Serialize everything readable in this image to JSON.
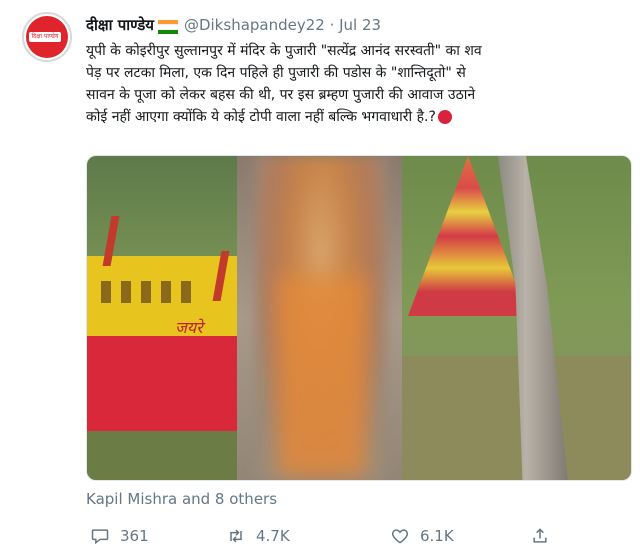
{
  "tweet": {
    "author_name": "दीक्षा पाण्डेय",
    "handle": "@Dikshapandey22 · Jul 23",
    "avatar_text": "दिक्षा पाण्डेय",
    "lines": [
      "यूपी के कोइरीपुर सुल्तानपुर में मंदिर के पुजारी \"सत्येंद्र आनंद सरस्वती\" का शव",
      "पेड़ पर लटका मिला, एक दिन पहिले ही पुजारी की पडोस के \"शान्तिदूतो\" से",
      "सावन के पूजा को लेकर बहस की थी, पर इस ब्रम्हण पुजारी की आवाज उठाने",
      "कोई नहीं आएगा क्योंकि ये कोई टोपी वाला नहीं बल्कि भगवाधारी है.?"
    ],
    "wall_scrawl": "जयरे"
  },
  "liked_by": "Kapil Mishra and 8 others",
  "actions": {
    "reply_count": "361",
    "retweet_count": "4.7K",
    "like_count": "6.1K"
  },
  "colors": {
    "text": "#14171a",
    "muted": "#657786",
    "flag_saffron": "#ff9933",
    "flag_white": "#ffffff",
    "flag_green": "#138808",
    "avatar_red": "#e0242b"
  },
  "icons": {
    "reply": "comment-bubble-icon",
    "retweet": "retweet-arrows-icon",
    "like": "heart-icon",
    "share": "share-icon",
    "flag": "india-flag-icon",
    "emoji": "crying-face-emoji-icon"
  }
}
